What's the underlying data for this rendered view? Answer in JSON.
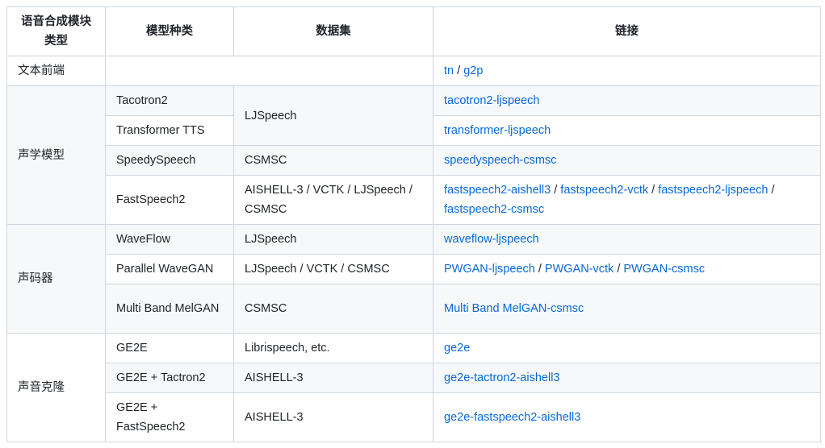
{
  "headers": [
    "语音合成模块类型",
    "模型种类",
    "数据集",
    "链接"
  ],
  "groups": {
    "frontend": "文本前端",
    "acoustic": "声学模型",
    "vocoder": "声码器",
    "clone": "声音克隆"
  },
  "rows": [
    {
      "model": "",
      "dataset": "",
      "links": [
        "tn",
        "g2p"
      ]
    },
    {
      "model": "Tacotron2",
      "dataset": "LJSpeech",
      "links": [
        "tacotron2-ljspeech"
      ]
    },
    {
      "model": "Transformer TTS",
      "dataset": "",
      "links": [
        "transformer-ljspeech"
      ]
    },
    {
      "model": "SpeedySpeech",
      "dataset": "CSMSC",
      "links": [
        "speedyspeech-csmsc"
      ]
    },
    {
      "model": "FastSpeech2",
      "dataset": "AISHELL-3 / VCTK / LJSpeech / CSMSC",
      "links": [
        "fastspeech2-aishell3",
        "fastspeech2-vctk",
        "fastspeech2-ljspeech",
        "fastspeech2-csmsc"
      ]
    },
    {
      "model": "WaveFlow",
      "dataset": "LJSpeech",
      "links": [
        "waveflow-ljspeech"
      ]
    },
    {
      "model": "Parallel WaveGAN",
      "dataset": "LJSpeech / VCTK / CSMSC",
      "links": [
        "PWGAN-ljspeech",
        "PWGAN-vctk",
        "PWGAN-csmsc"
      ]
    },
    {
      "model": "Multi Band MelGAN",
      "dataset": "CSMSC",
      "links": [
        "Multi Band MelGAN-csmsc"
      ]
    },
    {
      "model": "GE2E",
      "dataset": "Librispeech, etc.",
      "links": [
        "ge2e"
      ]
    },
    {
      "model": "GE2E + Tactron2",
      "dataset": "AISHELL-3",
      "links": [
        "ge2e-tactron2-aishell3"
      ]
    },
    {
      "model": "GE2E + FastSpeech2",
      "dataset": "AISHELL-3",
      "links": [
        "ge2e-fastspeech2-aishell3"
      ]
    }
  ],
  "colors": {
    "link": "#0969da",
    "border": "#d0d7de",
    "stripe": "#f6f8fa"
  }
}
